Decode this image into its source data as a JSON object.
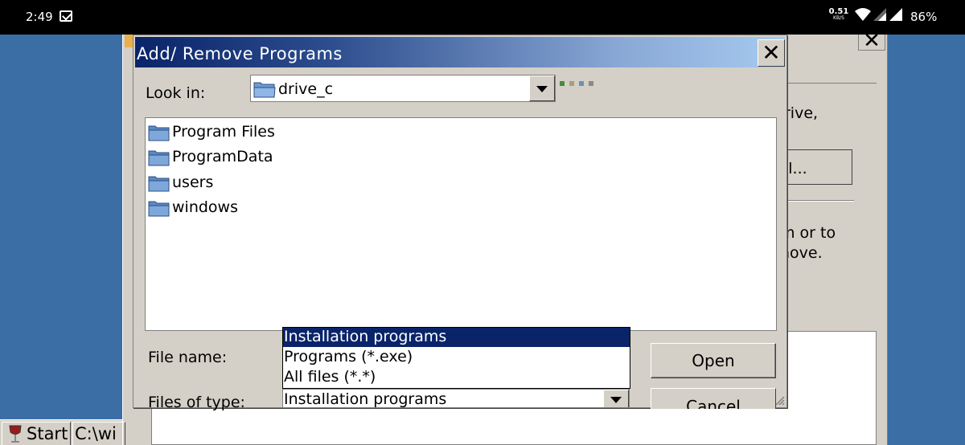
{
  "status_bar": {
    "time": "2:49",
    "net_speed": "0.51",
    "net_unit": "KB/S",
    "battery": "86%"
  },
  "background_window": {
    "text_right_1": "rive,",
    "button_label": "ll...",
    "text_right_2": "m or to",
    "text_right_3": "nove."
  },
  "taskbar": {
    "start_label": "Start",
    "task_label": "C:\\wi"
  },
  "dialog": {
    "title": "Add/ Remove Programs",
    "close_glyph": "✕",
    "look_in_label": "Look in:",
    "look_in_value": "drive_c",
    "files": [
      {
        "name": "Program Files",
        "icon": "folder-icon"
      },
      {
        "name": "ProgramData",
        "icon": "folder-icon"
      },
      {
        "name": "users",
        "icon": "folder-icon"
      },
      {
        "name": "windows",
        "icon": "folder-icon"
      }
    ],
    "file_name_label": "File name:",
    "files_of_type_label": "Files of type:",
    "files_of_type_value": "Installation programs",
    "type_options": [
      "Installation programs",
      "Programs (*.exe)",
      "All files (*.*)"
    ],
    "selected_type_index": 0,
    "open_label": "Open",
    "cancel_label": "Cancel"
  },
  "colors": {
    "desktop": "#3a6ea5",
    "title_gradient_start": "#0a246a",
    "title_gradient_end": "#a6caf0",
    "selection": "#0a246a",
    "face": "#d4d0c8"
  }
}
